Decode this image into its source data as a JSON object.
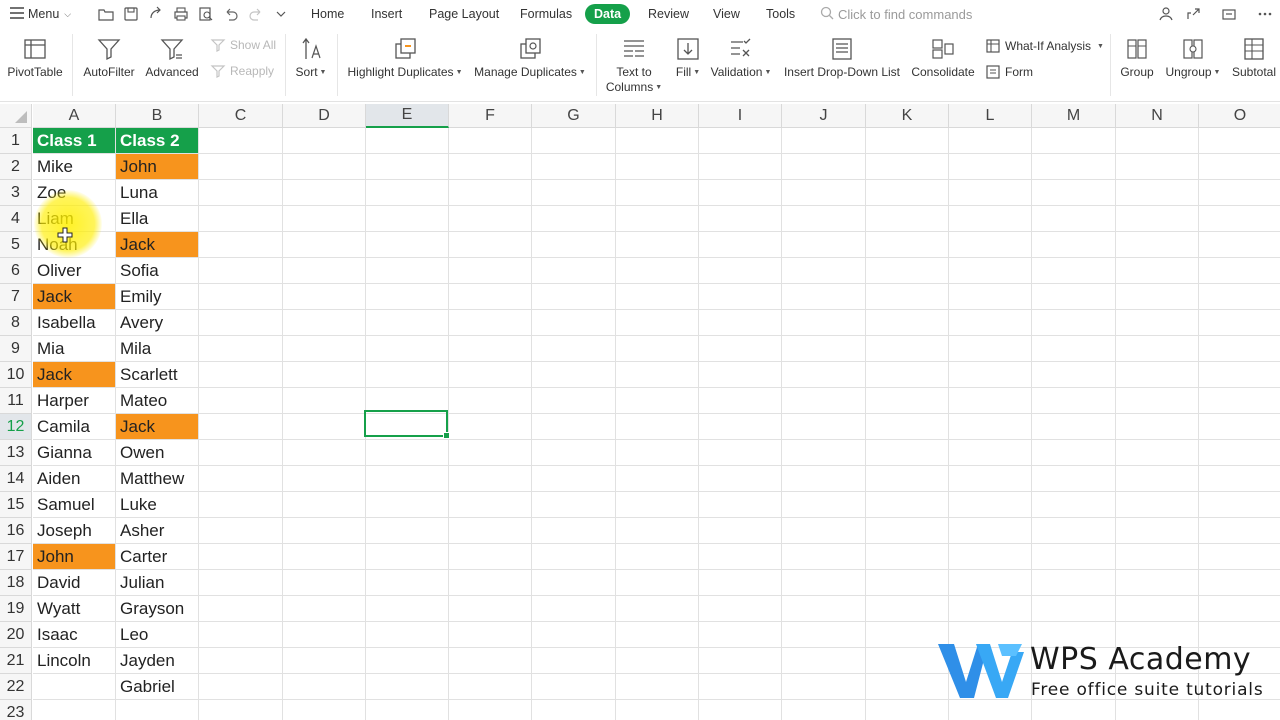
{
  "menubar": {
    "menu_label": "Menu",
    "tabs": [
      {
        "label": "Home"
      },
      {
        "label": "Insert"
      },
      {
        "label": "Page Layout"
      },
      {
        "label": "Formulas"
      },
      {
        "label": "Data",
        "active": true
      },
      {
        "label": "Review"
      },
      {
        "label": "View"
      },
      {
        "label": "Tools"
      }
    ],
    "search_placeholder": "Click to find commands"
  },
  "ribbon": {
    "pivot_table": "PivotTable",
    "autofilter": "AutoFilter",
    "advanced": "Advanced",
    "show_all": "Show All",
    "reapply": "Reapply",
    "sort": "Sort",
    "highlight_duplicates": "Highlight Duplicates",
    "manage_duplicates": "Manage Duplicates",
    "text_to_columns_1": "Text to",
    "text_to_columns_2": "Columns",
    "fill": "Fill",
    "validation": "Validation",
    "insert_dropdown": "Insert Drop-Down List",
    "consolidate": "Consolidate",
    "what_if": "What-If Analysis",
    "form": "Form",
    "group": "Group",
    "ungroup": "Ungroup",
    "subtotal": "Subtotal"
  },
  "sheet": {
    "columns": [
      "A",
      "B",
      "C",
      "D",
      "E",
      "F",
      "G",
      "H",
      "I",
      "J",
      "K",
      "L",
      "M",
      "N",
      "O"
    ],
    "selected_column": "E",
    "selected_row": 12,
    "rows": [
      {
        "n": "1",
        "a": "Class 1",
        "b": "Class 2"
      },
      {
        "n": "2",
        "a": "Mike",
        "b": "John"
      },
      {
        "n": "3",
        "a": "Zoe",
        "b": "Luna"
      },
      {
        "n": "4",
        "a": "Liam",
        "b": "Ella"
      },
      {
        "n": "5",
        "a": "Noah",
        "b": "Jack"
      },
      {
        "n": "6",
        "a": "Oliver",
        "b": "Sofia"
      },
      {
        "n": "7",
        "a": "Jack",
        "b": "Emily"
      },
      {
        "n": "8",
        "a": "Isabella",
        "b": "Avery"
      },
      {
        "n": "9",
        "a": "Mia",
        "b": "Mila"
      },
      {
        "n": "10",
        "a": "Jack",
        "b": "Scarlett"
      },
      {
        "n": "11",
        "a": "Harper",
        "b": "Mateo"
      },
      {
        "n": "12",
        "a": "Camila",
        "b": "Jack"
      },
      {
        "n": "13",
        "a": "Gianna",
        "b": "Owen"
      },
      {
        "n": "14",
        "a": "Aiden",
        "b": "Matthew"
      },
      {
        "n": "15",
        "a": "Samuel",
        "b": "Luke"
      },
      {
        "n": "16",
        "a": "Joseph",
        "b": "Asher"
      },
      {
        "n": "17",
        "a": "John",
        "b": "Carter"
      },
      {
        "n": "18",
        "a": "David",
        "b": "Julian"
      },
      {
        "n": "19",
        "a": "Wyatt",
        "b": "Grayson"
      },
      {
        "n": "20",
        "a": "Isaac",
        "b": "Leo"
      },
      {
        "n": "21",
        "a": "Lincoln",
        "b": "Jayden"
      },
      {
        "n": "22",
        "a": "",
        "b": "Gabriel"
      },
      {
        "n": "23",
        "a": "",
        "b": ""
      }
    ],
    "duplicate_cells": [
      "B2",
      "B5",
      "A7",
      "A10",
      "B12",
      "A17"
    ],
    "header_color": "#15a04a",
    "duplicate_color": "#f7941d"
  },
  "watermark": {
    "title": "WPS Academy",
    "subtitle": "Free office suite tutorials"
  }
}
